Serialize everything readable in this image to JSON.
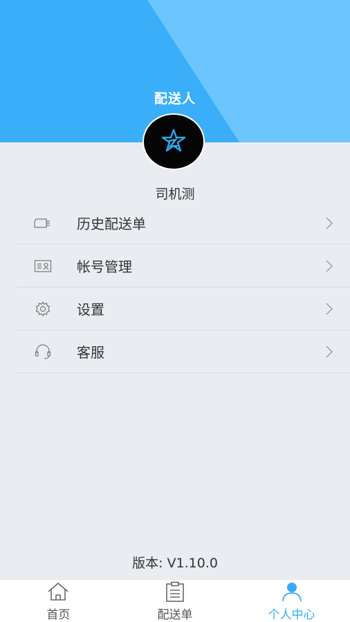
{
  "header": {
    "title": "配送人"
  },
  "profile": {
    "username": "司机测"
  },
  "menu": {
    "items": [
      {
        "label": "历史配送单",
        "icon": "truck-icon"
      },
      {
        "label": "帐号管理",
        "icon": "id-card-icon"
      },
      {
        "label": "设置",
        "icon": "gear-icon"
      },
      {
        "label": "客服",
        "icon": "headset-icon"
      }
    ]
  },
  "footer": {
    "version": "版本: V1.10.0"
  },
  "tabbar": {
    "tabs": [
      {
        "label": "首页",
        "icon": "home-icon",
        "active": false
      },
      {
        "label": "配送单",
        "icon": "clipboard-icon",
        "active": false
      },
      {
        "label": "个人中心",
        "icon": "user-icon",
        "active": true
      }
    ]
  },
  "colors": {
    "header_primary": "#3aaef9",
    "header_light": "#6dc5fd",
    "background": "#e9edf1",
    "accent": "#35aaf5",
    "avatar_bg": "#050505"
  }
}
